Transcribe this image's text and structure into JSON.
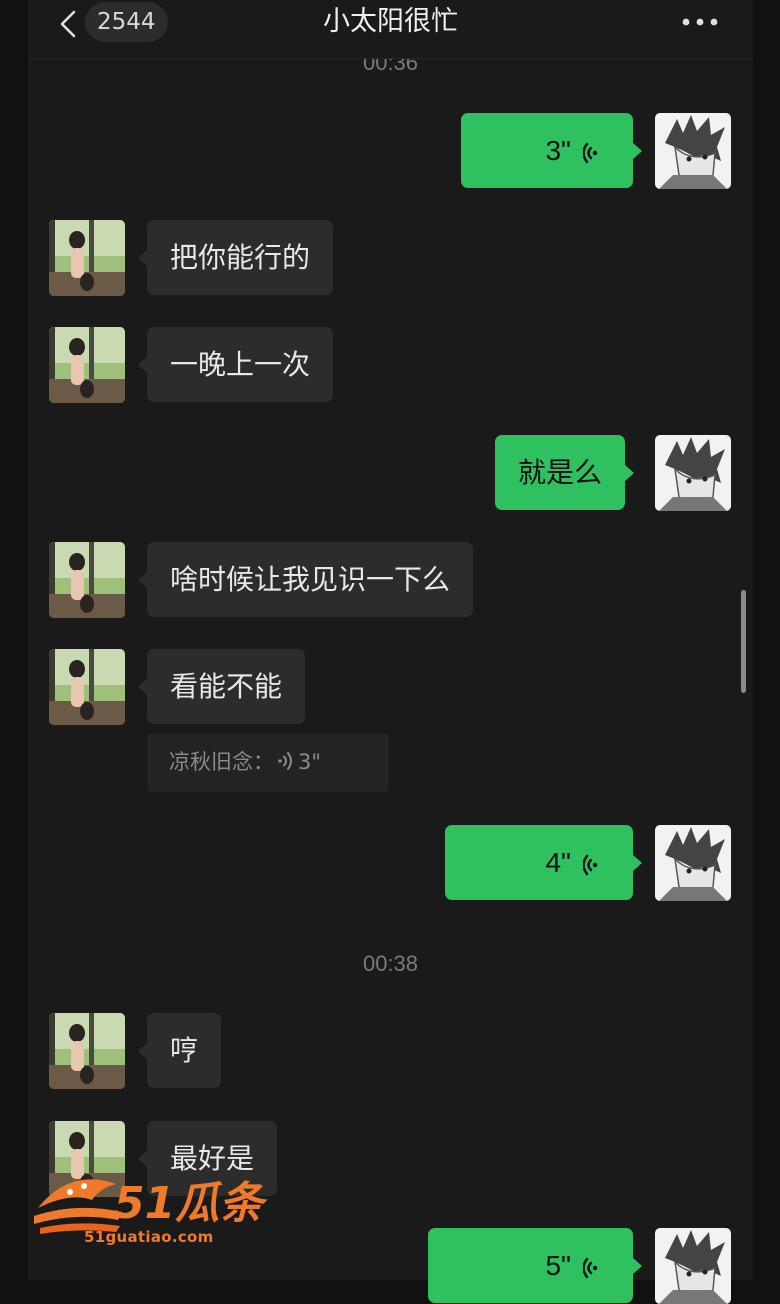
{
  "header": {
    "unread_count": "2544",
    "title": "小太阳很忙",
    "back_icon": "chevron-left-icon",
    "more_icon": "more-dots-icon"
  },
  "timestamps": [
    "00:36",
    "00:38"
  ],
  "messages": [
    {
      "side": "out",
      "type": "voice",
      "duration": "3\""
    },
    {
      "side": "in",
      "type": "text",
      "text": "把你能行的"
    },
    {
      "side": "in",
      "type": "text",
      "text": "一晚上一次"
    },
    {
      "side": "out",
      "type": "text",
      "text": "就是么"
    },
    {
      "side": "in",
      "type": "text",
      "text": "啥时候让我见识一下么"
    },
    {
      "side": "in",
      "type": "text",
      "text": "看能不能"
    },
    {
      "side": "out",
      "type": "voice",
      "duration": "4\""
    },
    {
      "side": "in",
      "type": "text",
      "text": "哼"
    },
    {
      "side": "in",
      "type": "text",
      "text": "最好是"
    },
    {
      "side": "out",
      "type": "voice",
      "duration": "5\""
    }
  ],
  "quote": {
    "sender": "凉秋旧念：",
    "duration": "3\""
  },
  "watermark": {
    "logo_text": "51瓜条",
    "url": "51guatiao.com"
  },
  "colors": {
    "background": "#1a1a1a",
    "outgoing_bubble": "#2fc05f",
    "incoming_bubble": "#2c2c2c",
    "accent_watermark": "#f07a2b"
  }
}
